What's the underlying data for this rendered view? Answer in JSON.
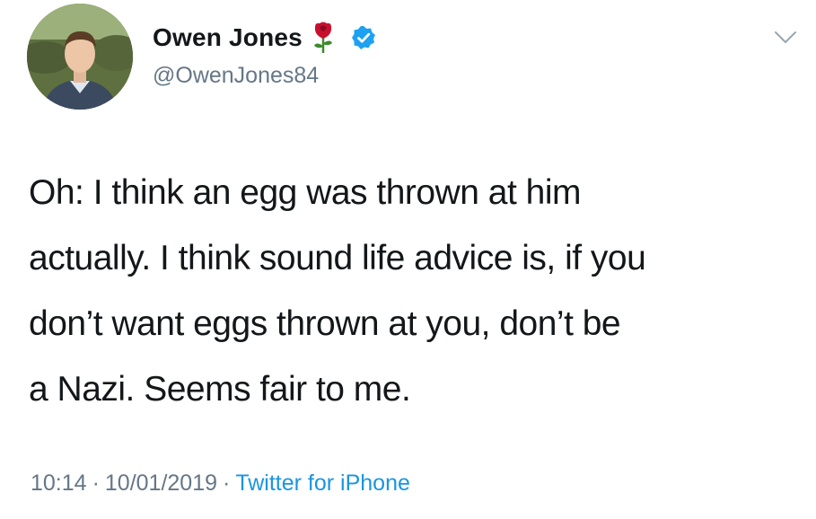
{
  "tweet": {
    "author": {
      "display_name": "Owen Jones",
      "handle": "@OwenJones84",
      "emoji_icon": "rose-icon",
      "verified_icon": "verified-badge-icon"
    },
    "text_lines": [
      "Oh: I think an egg was thrown at him",
      "actually. I think sound life advice is, if you",
      "don’t want eggs thrown at you, don’t be",
      "a Nazi. Seems fair to me."
    ],
    "time": "10:14",
    "date": "10/01/2019",
    "separator": "·",
    "source": "Twitter for iPhone",
    "menu_icon": "chevron-down-icon"
  },
  "colors": {
    "text": "#14171a",
    "secondary": "#657786",
    "link": "#1b95e0",
    "verified": "#1da1f2",
    "rose": "#c8102e"
  }
}
